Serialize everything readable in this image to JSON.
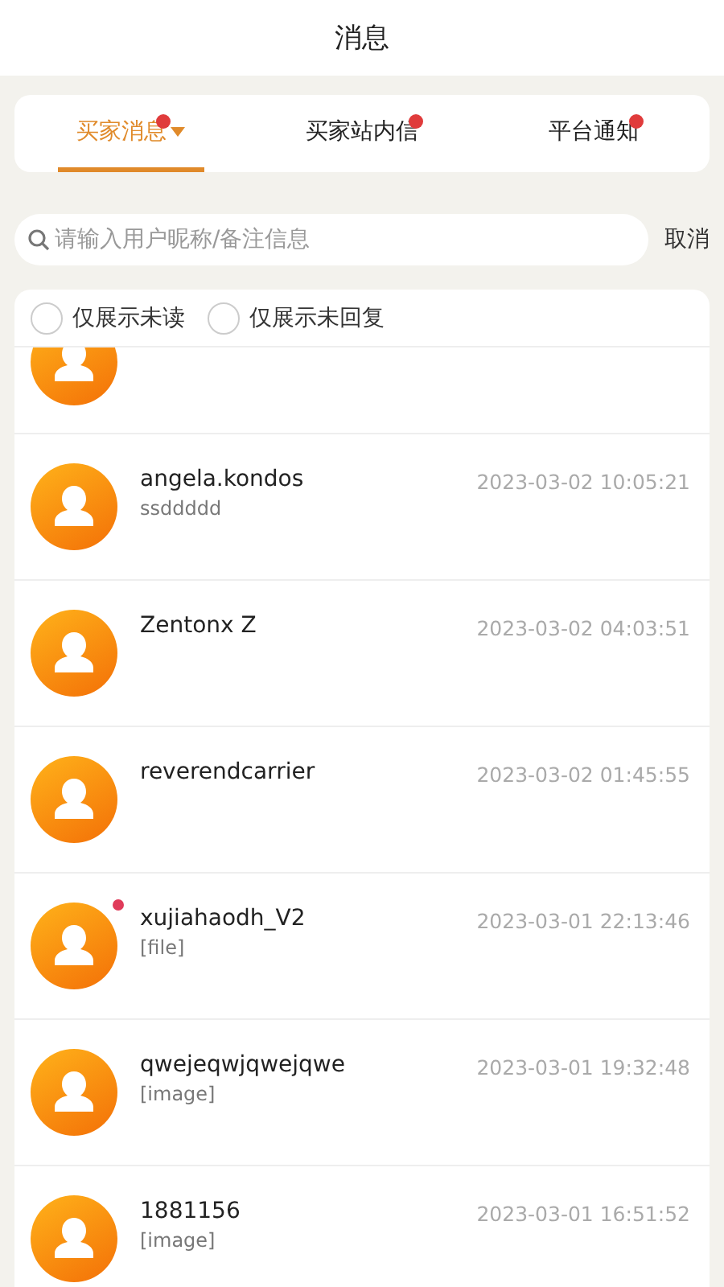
{
  "header": {
    "title": "消息"
  },
  "tabs": [
    {
      "label": "买家消息",
      "selected": true,
      "badge": true,
      "dropdown": true
    },
    {
      "label": "买家站内信",
      "selected": false,
      "badge": true,
      "dropdown": false
    },
    {
      "label": "平台通知",
      "selected": false,
      "badge": true,
      "dropdown": false
    }
  ],
  "search": {
    "placeholder": "请输入用户昵称/备注信息",
    "cancel": "取消"
  },
  "filters": [
    {
      "label": "仅展示未读",
      "checked": false
    },
    {
      "label": "仅展示未回复",
      "checked": false
    }
  ],
  "conversations": [
    {
      "cut_off": true,
      "unread": false
    },
    {
      "name": "angela.kondos",
      "preview": "ssddddd",
      "time": "2023-03-02 10:05:21",
      "unread": false
    },
    {
      "name": "Zentonx Z",
      "time": "2023-03-02 04:03:51",
      "unread": false
    },
    {
      "name": "reverendcarrier",
      "time": "2023-03-02 01:45:55",
      "unread": false
    },
    {
      "name": "xujiahaodh_V2",
      "preview": "[file]",
      "time": "2023-03-01 22:13:46",
      "unread": true
    },
    {
      "name": "qwejeqwjqwejqwe",
      "preview": "[image]",
      "time": "2023-03-01 19:32:48",
      "unread": false
    },
    {
      "name": "1881156",
      "preview": "[image]",
      "time": "2023-03-01 16:51:52",
      "unread": false
    }
  ]
}
